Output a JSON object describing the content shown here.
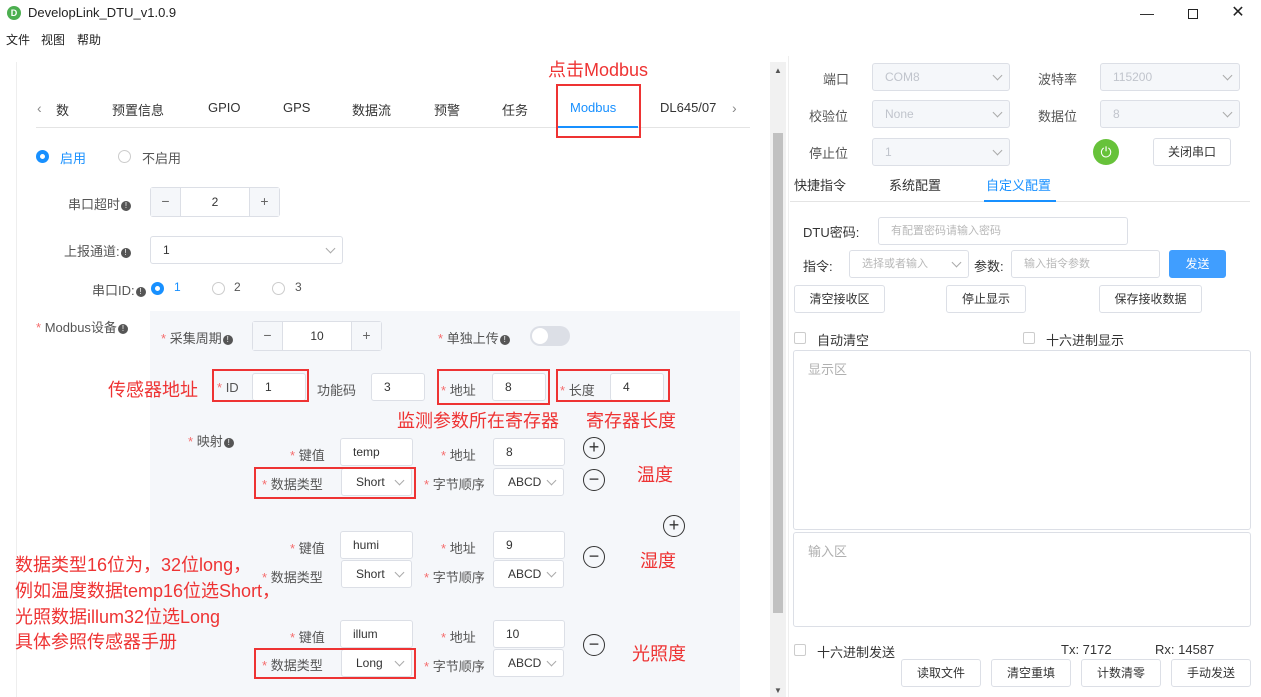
{
  "window": {
    "title": "DevelopLink_DTU_v1.0.9",
    "icon_letter": "D",
    "min_icon": "minimize-icon",
    "max_icon": "maximize-icon",
    "close_icon": "close-icon"
  },
  "menu": [
    "文件",
    "视图",
    "帮助"
  ],
  "tabs": [
    {
      "label": "数",
      "active": false
    },
    {
      "label": "预置信息",
      "active": false
    },
    {
      "label": "GPIO",
      "active": false
    },
    {
      "label": "GPS",
      "active": false
    },
    {
      "label": "数据流",
      "active": false
    },
    {
      "label": "预警",
      "active": false
    },
    {
      "label": "任务",
      "active": false
    },
    {
      "label": "Modbus",
      "active": true
    },
    {
      "label": "DL645/07",
      "active": false
    }
  ],
  "enable": {
    "on_label": "启用",
    "off_label": "不启用",
    "selected": "启用"
  },
  "serial_timeout": {
    "label": "串口超时",
    "value": "2"
  },
  "report_channel": {
    "label": "上报通道:",
    "value": "1"
  },
  "serial_id": {
    "label": "串口ID:",
    "options": [
      "1",
      "2",
      "3"
    ],
    "selected": "1"
  },
  "modbus": {
    "label": "Modbus设备",
    "period_label": "采集周期",
    "period_value": "10",
    "single_upload_label": "单独上传",
    "single_upload_on": false,
    "id_label": "ID",
    "id_value": "1",
    "func_label": "功能码",
    "func_value": "3",
    "addr_label": "地址",
    "addr_value": "8",
    "len_label": "长度",
    "len_value": "4",
    "mapping_label": "映射",
    "key_label": "键值",
    "type_label": "数据类型",
    "map_addr_label": "地址",
    "order_label": "字节顺序",
    "mappings": [
      {
        "key": "temp",
        "addr": "8",
        "type": "Short",
        "order": "ABCD"
      },
      {
        "key": "humi",
        "addr": "9",
        "type": "Short",
        "order": "ABCD"
      },
      {
        "key": "illum",
        "addr": "10",
        "type": "Long",
        "order": "ABCD"
      }
    ]
  },
  "annotations": {
    "click_modbus": "点击Modbus",
    "sensor_addr": "传感器地址",
    "register_param": "监测参数所在寄存器",
    "register_len": "寄存器长度",
    "temp": "温度",
    "humi": "湿度",
    "illum": "光照度",
    "note_lines": [
      "数据类型16位为，32位long，",
      "例如温度数据temp16位选Short，",
      "光照数据illum32位选Long",
      "具体参照传感器手册"
    ]
  },
  "serial": {
    "port_label": "端口",
    "port_value": "COM8",
    "baud_label": "波特率",
    "baud_value": "115200",
    "parity_label": "校验位",
    "parity_value": "None",
    "databits_label": "数据位",
    "databits_value": "8",
    "stopbits_label": "停止位",
    "stopbits_value": "1",
    "close_label": "关闭串口"
  },
  "right_tabs": [
    {
      "label": "快捷指令",
      "active": false
    },
    {
      "label": "系统配置",
      "active": false
    },
    {
      "label": "自定义配置",
      "active": true
    }
  ],
  "custom": {
    "pwd_label": "DTU密码:",
    "pwd_placeholder": "有配置密码请输入密码",
    "cmd_label": "指令:",
    "cmd_placeholder": "选择或者输入",
    "param_label": "参数:",
    "param_placeholder": "输入指令参数",
    "send_label": "发送",
    "clear_recv_label": "清空接收区",
    "stop_display_label": "停止显示",
    "save_recv_label": "保存接收数据",
    "auto_clear_label": "自动清空",
    "hex_display_label": "十六进制显示",
    "display_placeholder": "显示区",
    "input_placeholder": "输入区",
    "hex_send_label": "十六进制发送",
    "tx": "Tx: 7172",
    "rx": "Rx: 14587",
    "read_file_label": "读取文件",
    "clear_refill_label": "清空重填",
    "reset_count_label": "计数清零",
    "manual_send_label": "手动发送"
  }
}
